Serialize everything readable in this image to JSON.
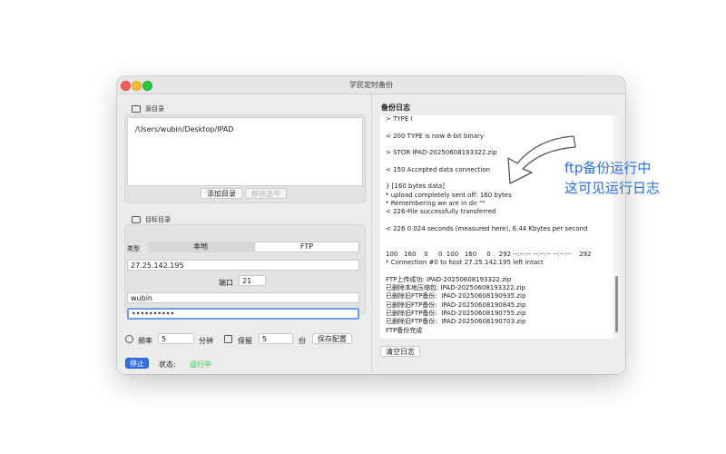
{
  "window": {
    "title": "学民定时备份"
  },
  "source": {
    "label": "源目录",
    "path": "/Users/wubin/Desktop/IPAD",
    "add_label": "添加目录",
    "remove_label": "移除选中"
  },
  "target": {
    "label": "目标目录",
    "type_label": "类型",
    "type_options": [
      "本地",
      "FTP"
    ],
    "selected_type": "FTP",
    "host": "27.25.142.195",
    "port_label": "端口",
    "port": "21",
    "username": "wubin",
    "password_masked": "••••••••••"
  },
  "schedule": {
    "freq_label": "频率",
    "freq_value": "5",
    "freq_unit": "分钟",
    "keep_label": "保留",
    "keep_value": "5",
    "keep_unit": "份",
    "save_label": "保存配置"
  },
  "control": {
    "stop_label": "停止",
    "status_label": "状态:",
    "status_value": "运行中",
    "status_color": "#28c840"
  },
  "log": {
    "title": "备份日志",
    "lines": [
      "> TYPE I",
      "",
      "< 200 TYPE is now 8-bit binary",
      "",
      "> STOR IPAD-20250608193322.zip",
      "",
      "< 150 Accepted data connection",
      "",
      "} [160 bytes data]",
      "* upload completely sent off: 160 bytes",
      "* Remembering we are in dir \"\"",
      "< 226-File successfully transferred",
      "",
      "< 226 0.024 seconds (measured here), 6.44 Kbytes per second",
      "",
      "",
      "100   160    0     0  100   160     0    292 --:--:-- --:--:-- --:--:--    292",
      "* Connection #0 to host 27.25.142.195 left intact",
      "",
      "FTP上传成功: IPAD-20250608193322.zip",
      "已删除本地压缩包: IPAD-20250608193322.zip",
      "已删除旧FTP备份:  IPAD-20250608190935.zip",
      "已删除旧FTP备份:  IPAD-20250608190845.zip",
      "已删除旧FTP备份:  IPAD-20250608190755.zip",
      "已删除旧FTP备份:  IPAD-20250608190703.zip",
      "FTP备份完成"
    ],
    "clear_label": "清空日志"
  },
  "annotation": {
    "line1": "ftp备份运行中",
    "line2": "这可见运行日志",
    "color": "#2a6fd6"
  },
  "colors": {
    "accent": "#2f6fe0",
    "close": "#fe5f57",
    "minimize": "#febc2e",
    "maximize": "#28c840"
  }
}
